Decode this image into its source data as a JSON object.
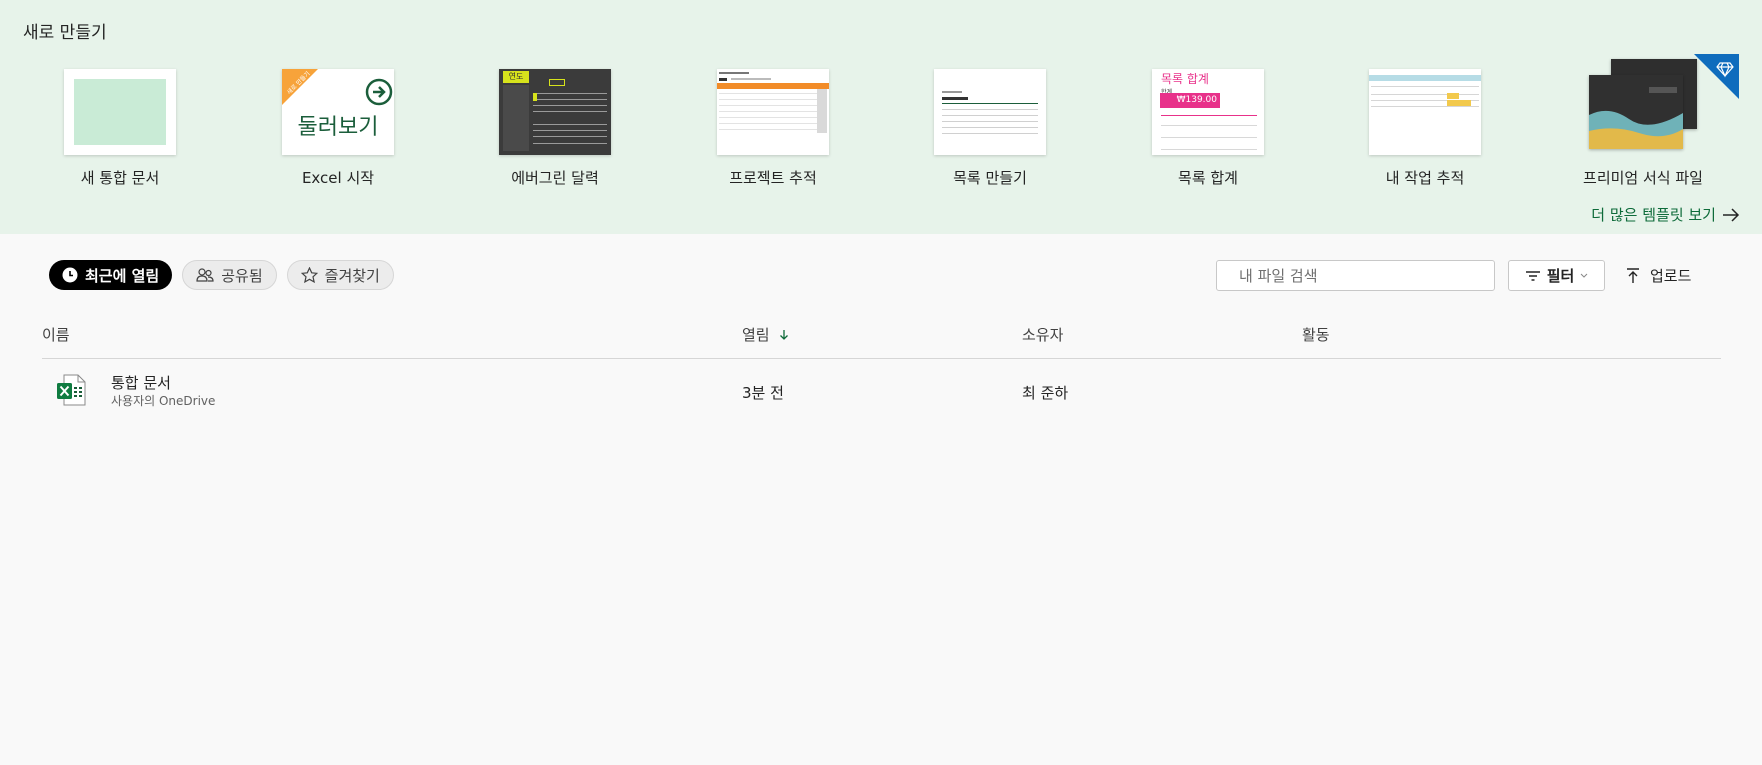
{
  "new_section": {
    "title": "새로 만들기",
    "templates": [
      {
        "label": "새 통합 문서",
        "icon": "blank-workbook-thumbnail"
      },
      {
        "label": "Excel 시작",
        "icon": "tour-thumbnail",
        "thumb_text": "둘러보기",
        "ribbon_text": "새로 만들기"
      },
      {
        "label": "에버그린 달력",
        "icon": "calendar-thumbnail",
        "thumb_text": "연도"
      },
      {
        "label": "프로젝트 추적",
        "icon": "project-tracker-thumbnail"
      },
      {
        "label": "목록 만들기",
        "icon": "make-list-thumbnail"
      },
      {
        "label": "목록 합계",
        "icon": "list-total-thumbnail",
        "thumb_title": "목록 합계",
        "thumb_sub": "합계",
        "thumb_amount": "₩139.00"
      },
      {
        "label": "내 작업 추적",
        "icon": "task-tracker-thumbnail"
      },
      {
        "label": "프리미엄 서식 파일",
        "icon": "premium-templates-thumbnail"
      }
    ],
    "more_link": "더 많은 템플릿 보기"
  },
  "tabs": [
    {
      "label": "최근에 열림",
      "icon": "clock-icon",
      "active": true
    },
    {
      "label": "공유됨",
      "icon": "people-icon",
      "active": false
    },
    {
      "label": "즐겨찾기",
      "icon": "star-icon",
      "active": false
    }
  ],
  "search": {
    "placeholder": "내 파일 검색"
  },
  "filter": {
    "label": "필터"
  },
  "upload": {
    "label": "업로드"
  },
  "table": {
    "columns": [
      "이름",
      "열림",
      "소유자",
      "활동"
    ],
    "rows": [
      {
        "name": "통합 문서",
        "location": "사용자의 OneDrive",
        "opened": "3분 전",
        "owner": "최 준하",
        "activity": ""
      }
    ]
  },
  "colors": {
    "accent_green": "#0e6b3a",
    "hero_bg": "#e7f3ea",
    "premium_blue": "#0f6cbd"
  }
}
